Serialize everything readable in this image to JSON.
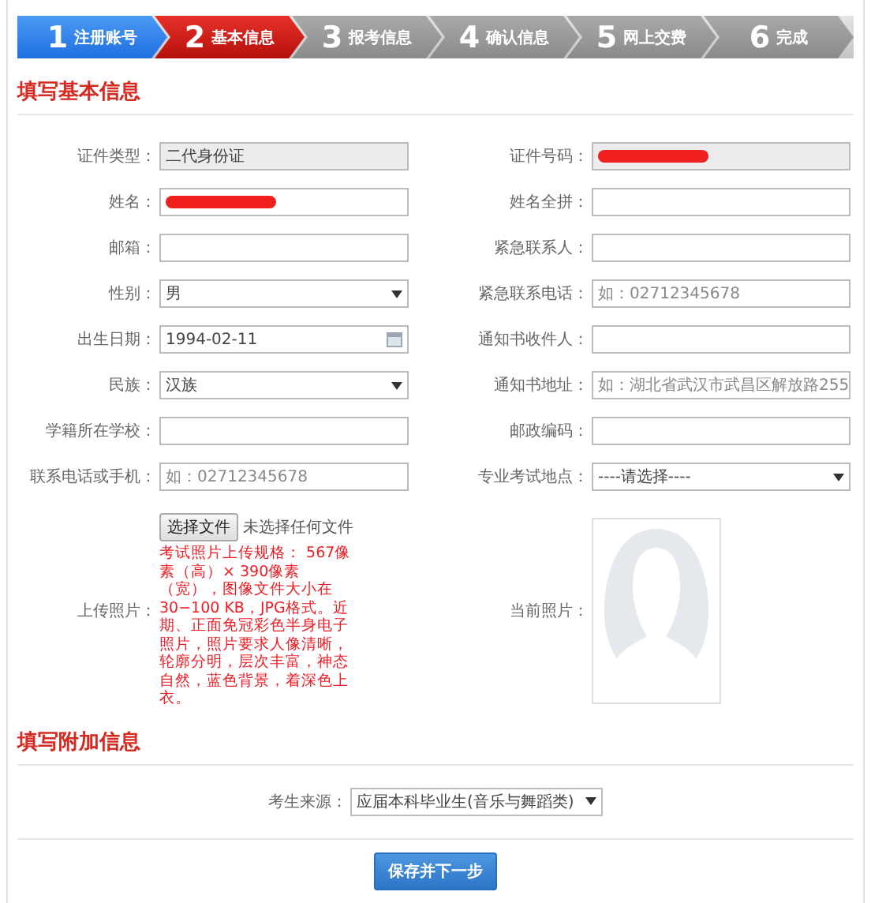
{
  "steps": [
    {
      "number": "1",
      "label": "注册账号",
      "completed": true,
      "selected": false
    },
    {
      "number": "2",
      "label": "基本信息",
      "completed": false,
      "selected": true
    },
    {
      "number": "3",
      "label": "报考信息",
      "completed": false,
      "selected": false
    },
    {
      "number": "4",
      "label": "确认信息",
      "completed": false,
      "selected": false
    },
    {
      "number": "5",
      "label": "网上交费",
      "completed": false,
      "selected": false
    },
    {
      "number": "6",
      "label": "完成",
      "completed": false,
      "selected": false
    }
  ],
  "basic_info": {
    "title": "填写基本信息",
    "rows": [
      {
        "left": {
          "label": "证件类型：",
          "kind": "text",
          "value": "二代身份证",
          "readonly": true,
          "redacted": false
        },
        "right": {
          "label": "证件号码：",
          "kind": "text",
          "readonly": true,
          "redacted": true
        }
      },
      {
        "left": {
          "label": "姓名：",
          "kind": "text",
          "readonly": false,
          "redacted": true
        },
        "right": {
          "label": "姓名全拼：",
          "kind": "text",
          "readonly": false,
          "redacted": false
        }
      },
      {
        "left": {
          "label": "邮箱：",
          "kind": "text",
          "readonly": false,
          "redacted": false
        },
        "right": {
          "label": "紧急联系人：",
          "kind": "text",
          "readonly": false,
          "redacted": false
        }
      },
      {
        "left": {
          "label": "性别：",
          "kind": "select",
          "value": "男",
          "readonly": false,
          "redacted": false
        },
        "right": {
          "label": "紧急联系电话：",
          "kind": "text",
          "placeholder": "如：02712345678",
          "readonly": false,
          "redacted": false
        }
      },
      {
        "left": {
          "label": "出生日期：",
          "kind": "date",
          "value": "1994-02-11",
          "readonly": false,
          "redacted": false
        },
        "right": {
          "label": "通知书收件人：",
          "kind": "text",
          "readonly": false,
          "redacted": false
        }
      },
      {
        "left": {
          "label": "民族：",
          "kind": "select",
          "value": "汉族",
          "readonly": false,
          "redacted": false
        },
        "right": {
          "label": "通知书地址：",
          "kind": "text",
          "placeholder": "如：湖北省武汉市武昌区解放路255",
          "readonly": false,
          "redacted": false
        }
      },
      {
        "left": {
          "label": "学籍所在学校：",
          "kind": "text",
          "readonly": false,
          "redacted": false
        },
        "right": {
          "label": "邮政编码：",
          "kind": "text",
          "readonly": false,
          "redacted": false
        }
      },
      {
        "left": {
          "label": "联系电话或手机：",
          "kind": "text",
          "placeholder": "如：02712345678",
          "readonly": false,
          "redacted": false
        },
        "right": {
          "label": "专业考试地点：",
          "kind": "select",
          "value": "----请选择----",
          "readonly": false,
          "redacted": false
        }
      }
    ],
    "upload": {
      "label": "上传照片：",
      "button": "选择文件",
      "file_status": "未选择任何文件",
      "hint": "考试照片上传规格： 567像素（高）× 390像素（宽），图像文件大小在30−100 KB，JPG格式。近期、正面免冠彩色半身电子照片，照片要求人像清晰，轮廓分明，层次丰富，神态自然，蓝色背景，着深色上衣。"
    },
    "current_photo": {
      "label": "当前照片："
    }
  },
  "additional_info": {
    "title": "填写附加信息",
    "field": {
      "label": "考生来源：",
      "kind": "select",
      "value": "应届本科毕业生(音乐与舞蹈类)"
    }
  },
  "submit_button": "保存并下一步"
}
